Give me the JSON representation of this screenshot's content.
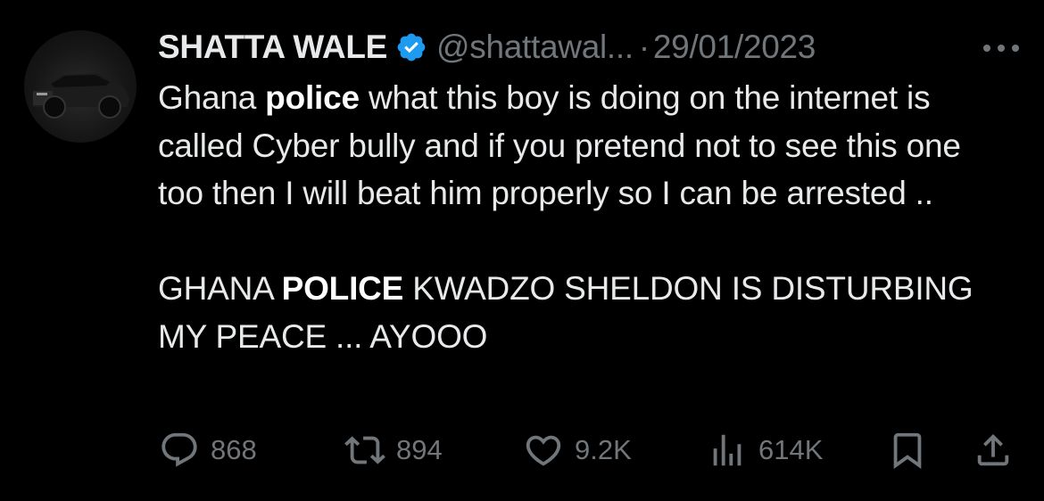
{
  "author": {
    "name": "SHATTA WALE",
    "handle": "@shattawal...",
    "separator": "·",
    "date": "29/01/2023",
    "verified_color": "#1d9bf0"
  },
  "tweet": {
    "paragraph1": {
      "t1": "Ghana ",
      "b1": "police",
      "t2": " what this boy is doing on the internet is called Cyber bully and if you pretend not to see this one too then I will beat him properly so I can be arrested .."
    },
    "paragraph2": {
      "t1": "GHANA ",
      "b1": "POLICE",
      "t2": " KWADZO SHELDON IS DISTURBING MY PEACE ... AYOOO"
    }
  },
  "actions": {
    "replies": "868",
    "reposts": "894",
    "likes": "9.2K",
    "views": "614K"
  },
  "icons": {
    "more": "more-horizontal-icon",
    "reply": "reply-bubble-icon",
    "repost": "repost-arrows-icon",
    "like": "heart-icon",
    "views": "bar-chart-icon",
    "bookmark": "bookmark-icon",
    "share": "share-upload-icon",
    "verified": "verified-badge-icon"
  }
}
